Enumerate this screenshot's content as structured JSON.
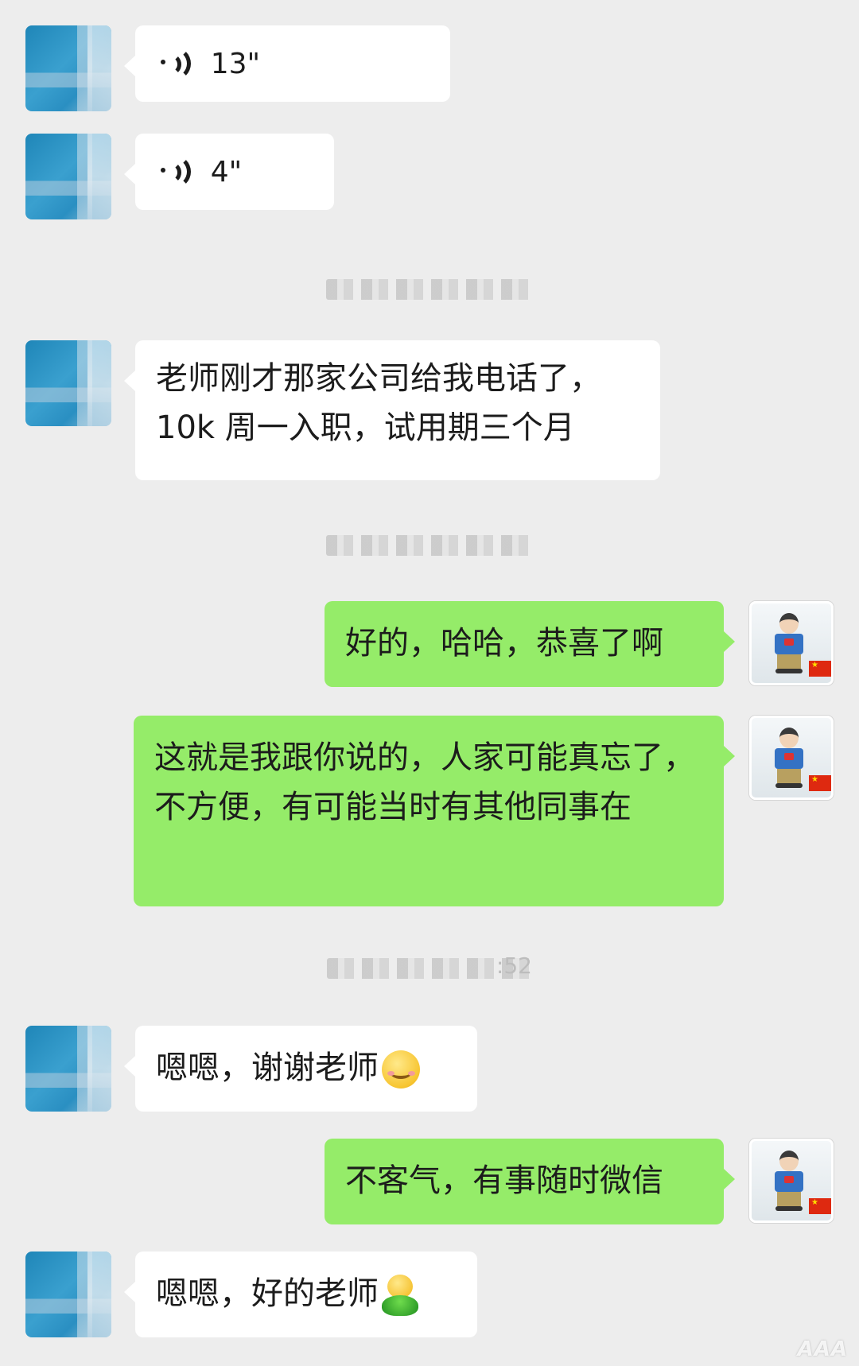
{
  "messages": [
    {
      "side": "in",
      "type": "voice",
      "duration": "13\""
    },
    {
      "side": "in",
      "type": "voice",
      "duration": "4\""
    },
    {
      "side": "in",
      "type": "text",
      "text": "老师刚才那家公司给我电话了，10k 周一入职，试用期三个月"
    },
    {
      "side": "out",
      "type": "text",
      "text": "好的，哈哈，恭喜了啊"
    },
    {
      "side": "out",
      "type": "text",
      "text": "这就是我跟你说的，人家可能真忘了，不方便，有可能当时有其他同事在"
    },
    {
      "side": "in",
      "type": "text",
      "text": "嗯嗯，谢谢老师",
      "emoji": "smile-emoji"
    },
    {
      "side": "out",
      "type": "text",
      "text": "不客气，有事随时微信"
    },
    {
      "side": "in",
      "type": "text",
      "text": "嗯嗯，好的老师",
      "emoji": "green-bean-emoji"
    }
  ],
  "timestamps": {
    "third": {
      "visible_text": ":52"
    }
  },
  "watermark": "AAA",
  "colors": {
    "background": "#ededed",
    "incoming_bubble": "#ffffff",
    "outgoing_bubble": "#95ec69",
    "text": "#1c1c1c"
  }
}
